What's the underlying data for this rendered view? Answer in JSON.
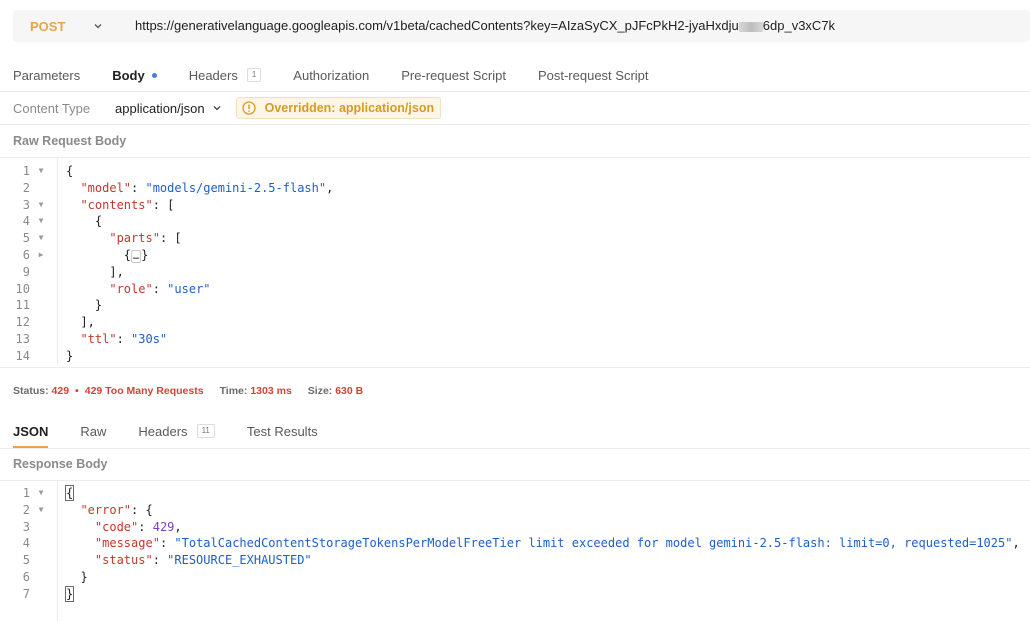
{
  "request": {
    "method": "POST",
    "url_prefix": "https://generativelanguage.googleapis.com/v1beta/cachedContents?key=AIzaSyCX_pJFcPkH2-jyaHxdju",
    "url_suffix": "6dp_v3xC7k"
  },
  "request_tabs": [
    {
      "label": "Parameters"
    },
    {
      "label": "Body"
    },
    {
      "label": "Headers",
      "count": "1"
    },
    {
      "label": "Authorization"
    },
    {
      "label": "Pre-request Script"
    },
    {
      "label": "Post-request Script"
    }
  ],
  "content_type": {
    "label": "Content Type",
    "value": "application/json",
    "override": "Overridden: application/json"
  },
  "request_body": {
    "label": "Raw Request Body"
  },
  "status": {
    "status_label": "Status:",
    "code": "429",
    "text": "429 Too Many Requests",
    "time_label": "Time:",
    "time": "1303 ms",
    "size_label": "Size:",
    "size": "630 B"
  },
  "response_tabs": [
    {
      "label": "JSON"
    },
    {
      "label": "Raw"
    },
    {
      "label": "Headers",
      "count": "11"
    },
    {
      "label": "Test Results"
    }
  ],
  "response_body": {
    "label": "Response Body"
  },
  "colors": {
    "method": "#e8a34c",
    "error": "#d04437",
    "key": "#c0392b",
    "string": "#1e5fc7",
    "number": "#7b3fc4",
    "override": "#d69b22"
  }
}
